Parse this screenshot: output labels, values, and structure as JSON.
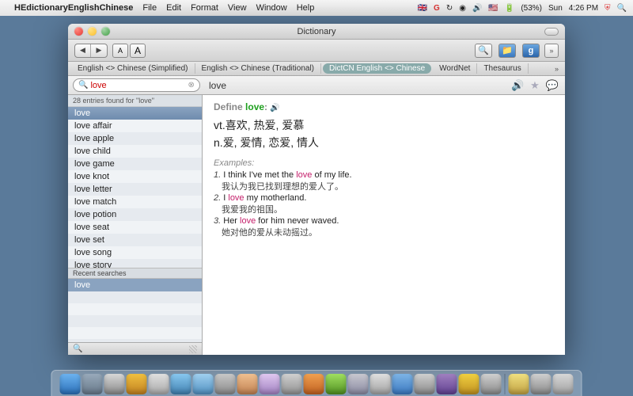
{
  "menubar": {
    "app_name": "HEdictionaryEnglishChinese",
    "items": [
      "File",
      "Edit",
      "Format",
      "View",
      "Window",
      "Help"
    ],
    "status": {
      "battery": "(53%)",
      "day": "Sun",
      "time": "4:26 PM"
    }
  },
  "window": {
    "title": "Dictionary",
    "toolbar": {
      "font_small": "A",
      "font_large": "A"
    },
    "tabs": {
      "items": [
        "English <> Chinese (Simplified)",
        "English <> Chinese (Traditional)",
        "DictCN English <> Chinese",
        "WordNet",
        "Thesaurus"
      ],
      "active_index": 2
    },
    "search": {
      "value": "love",
      "headword": "love"
    },
    "sidebar": {
      "count_text": "28 entries found for \"love\"",
      "entries": [
        "love",
        "love affair",
        "love apple",
        "love child",
        "love game",
        "love knot",
        "love letter",
        "love match",
        "love potion",
        "love seat",
        "love set",
        "love song",
        "love story"
      ],
      "selected_index": 0,
      "recent_header": "Recent searches",
      "recent": [
        "love"
      ],
      "spotlight_glyph": "🔍"
    },
    "content": {
      "define_label": "Define",
      "headword": "love",
      "definitions": [
        {
          "pos": "vt.",
          "zh": "喜欢, 热爱, 爱慕"
        },
        {
          "pos": "n.",
          "zh": "爱, 爱情, 恋爱, 情人"
        }
      ],
      "examples_header": "Examples:",
      "examples": [
        {
          "num": "1.",
          "pre": "I think I've met the ",
          "hw": "love",
          "post": " of my life.",
          "zh": "我认为我已找到理想的爱人了。"
        },
        {
          "num": "2.",
          "pre": "I ",
          "hw": "love",
          "post": " my motherland.",
          "zh": "我爱我的祖国。"
        },
        {
          "num": "3.",
          "pre": "Her ",
          "hw": "love",
          "post": " for him never waved.",
          "zh": "她对他的爱从未动摇过。"
        }
      ]
    }
  }
}
